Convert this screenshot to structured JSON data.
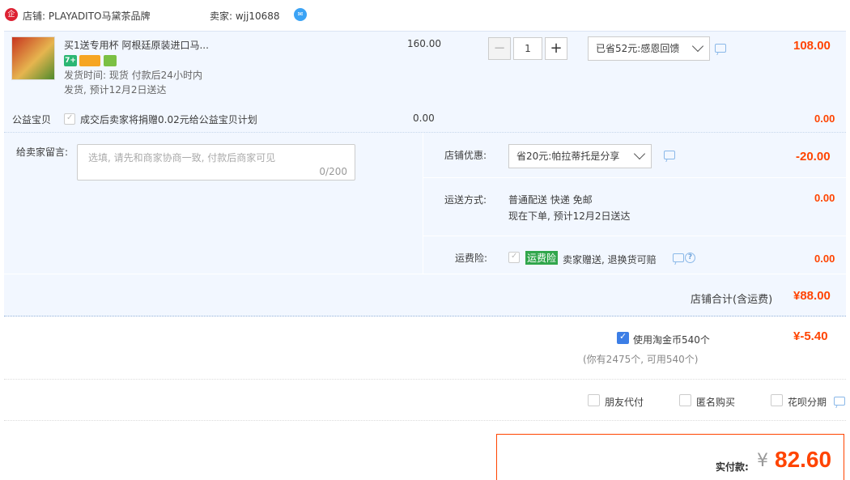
{
  "shop": {
    "shop_label": "店铺: PLAYADITO马黛茶品牌",
    "seller_label": "卖家: wjj10688",
    "shop_icon_text": "企"
  },
  "item": {
    "title": "买1送专用杯 阿根廷原装进口马...",
    "ship_time": "发货时间: 现货 付款后24小时内",
    "ship_eta": "发货, 预计12月2日送达",
    "unit_price": "160.00",
    "quantity": "1",
    "minus_label": "−",
    "plus_label": "+",
    "discount_select": "已省52元:感恩回馈",
    "subtotal": "108.00",
    "badge_tianmao": "7+"
  },
  "charity": {
    "label": "公益宝贝",
    "text": "成交后卖家将捐赠0.02元给公益宝贝计划",
    "price": "0.00",
    "amount": "0.00"
  },
  "message": {
    "label": "给卖家留言:",
    "placeholder": "选填, 请先和商家协商一致, 付款后商家可见",
    "counter": "0/200"
  },
  "shop_discount": {
    "label": "店铺优惠:",
    "select": "省20元:帕拉蒂托是分享",
    "amount": "-20.00"
  },
  "shipping": {
    "label": "运送方式:",
    "method": "普通配送 快递 免邮",
    "eta": "现在下单, 预计12月2日送达",
    "amount": "0.00"
  },
  "insurance": {
    "label": "运费险:",
    "tag": "运费险",
    "text": "卖家赠送, 退换货可赔",
    "amount": "0.00"
  },
  "shop_total": {
    "label": "店铺合计(含运费)",
    "amount": "¥88.00"
  },
  "coins": {
    "label": "使用淘金币540个",
    "sub": "(你有2475个, 可用540个)",
    "amount": "¥-5.40"
  },
  "options": {
    "friend_pay": "朋友代付",
    "anonymous": "匿名购买",
    "huabei": "花呗分期"
  },
  "payment": {
    "label": "实付款:",
    "currency": "¥",
    "amount": "82.60"
  }
}
